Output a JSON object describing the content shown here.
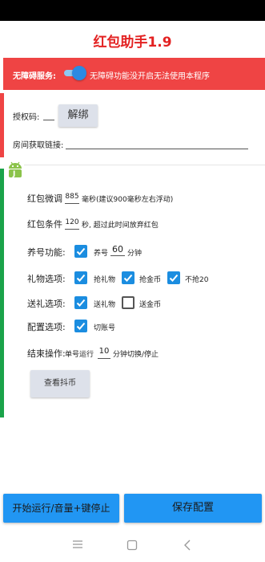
{
  "app": {
    "title": "红包助手1.9"
  },
  "accessibility": {
    "label": "无障碍服务:",
    "enabled": true,
    "description": "无障碍功能没开启无法使用本程序"
  },
  "auth": {
    "code_label": "授权码:",
    "code_value": "__",
    "unbind_button": "解绑",
    "room_link_label": "房间获取链接:",
    "room_link_value": ""
  },
  "settings": {
    "micro_adjust": {
      "label": "红包微调",
      "value": "885",
      "unit_hint": "毫秒(建议900毫秒左右浮动)"
    },
    "condition": {
      "label": "红包条件",
      "value": "120",
      "suffix": "秒, 超过此时间放弃红包"
    },
    "nurture": {
      "label": "养号功能:",
      "checkbox_label": "养号",
      "checked": true,
      "value": "60",
      "unit": "分钟"
    },
    "gift_options": {
      "label": "礼物选项:",
      "items": [
        {
          "label": "抢礼物",
          "checked": true
        },
        {
          "label": "抢金币",
          "checked": true
        },
        {
          "label": "不抢20",
          "checked": true
        }
      ]
    },
    "send_gift": {
      "label": "送礼选项:",
      "items": [
        {
          "label": "送礼物",
          "checked": true
        },
        {
          "label": "送金币",
          "checked": false
        }
      ]
    },
    "config_options": {
      "label": "配置选项:",
      "items": [
        {
          "label": "切账号",
          "checked": true
        }
      ]
    },
    "end_operation": {
      "label": "结束操作:",
      "prefix": "单号运行",
      "value": "10",
      "suffix": "分钟切换/停止"
    },
    "view_coins_button": "查看抖币"
  },
  "bottom_buttons": {
    "start": "开始运行/音量+键停止",
    "save": "保存配置"
  },
  "icons": [
    "android-icon",
    "check-icon",
    "menu-icon",
    "home-icon",
    "back-icon"
  ],
  "colors": {
    "brand_red": "#e32222",
    "banner_red": "#ef4444",
    "accent_blue": "#2196f3",
    "checkbox_blue": "#1b8de0",
    "green_bar": "#1aa34a"
  }
}
